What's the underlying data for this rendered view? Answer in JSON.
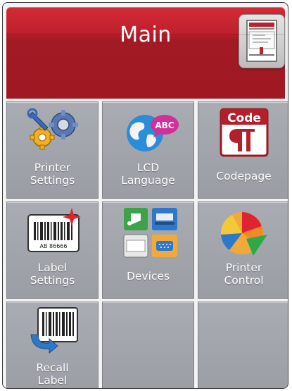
{
  "header": {
    "title": "Main",
    "printer_button_icon": "printer-icon"
  },
  "tiles": [
    {
      "line1": "Printer",
      "line2": "Settings",
      "icon": "gears-wrench-icon"
    },
    {
      "line1": "LCD",
      "line2": "Language",
      "icon": "globe-abc-icon"
    },
    {
      "line1": "Codepage",
      "line2": "",
      "icon": "code-pilcrow-icon"
    },
    {
      "line1": "Label",
      "line2": "Settings",
      "icon": "barcode-label-icon",
      "barcode_text": "AB 86666"
    },
    {
      "line1": "Devices",
      "line2": "",
      "icon": "devices-icon"
    },
    {
      "line1": "Printer",
      "line2": "Control",
      "icon": "pie-chart-icon"
    },
    {
      "line1": "Recall",
      "line2": "Label",
      "icon": "recall-barcode-icon"
    }
  ],
  "colors": {
    "header_red": "#b01e2a",
    "tile_gray": "#a1a5ab",
    "label_white": "#ffffff"
  }
}
